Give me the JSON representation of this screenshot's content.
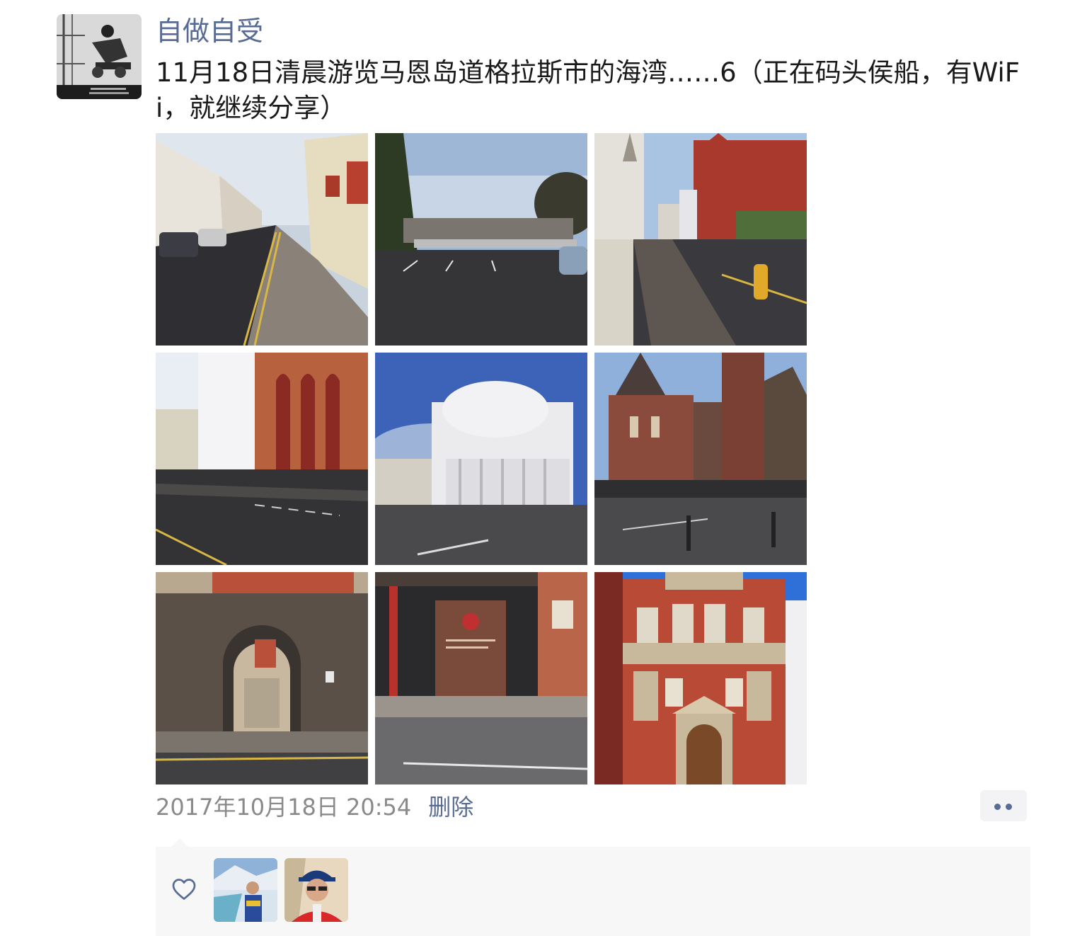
{
  "post": {
    "author": "自做自受",
    "avatar_icon": "man-working-photo-avatar",
    "text": "11月18日清晨游览马恩岛道格拉斯市的海湾……6（正在码头侯船，有WiFi，就继续分享）",
    "timestamp": "2017年10月18日 20:54",
    "delete_label": "删除",
    "photos": [
      {
        "name": "street-photo"
      },
      {
        "name": "parking-lot-photo"
      },
      {
        "name": "red-brick-building-street-photo"
      },
      {
        "name": "white-and-red-buildings-photo"
      },
      {
        "name": "white-rotunda-building-photo"
      },
      {
        "name": "stone-church-photo"
      },
      {
        "name": "stone-archway-photo"
      },
      {
        "name": "building-entrance-sign-photo"
      },
      {
        "name": "ornate-red-brick-building-photo"
      }
    ]
  },
  "likes": {
    "icon": "heart-icon",
    "users": [
      {
        "name": "liker-avatar-1"
      },
      {
        "name": "liker-avatar-2"
      }
    ]
  },
  "colors": {
    "link": "#576b95",
    "timestamp": "#8a8a8a",
    "likes_background": "#f7f7f7"
  }
}
